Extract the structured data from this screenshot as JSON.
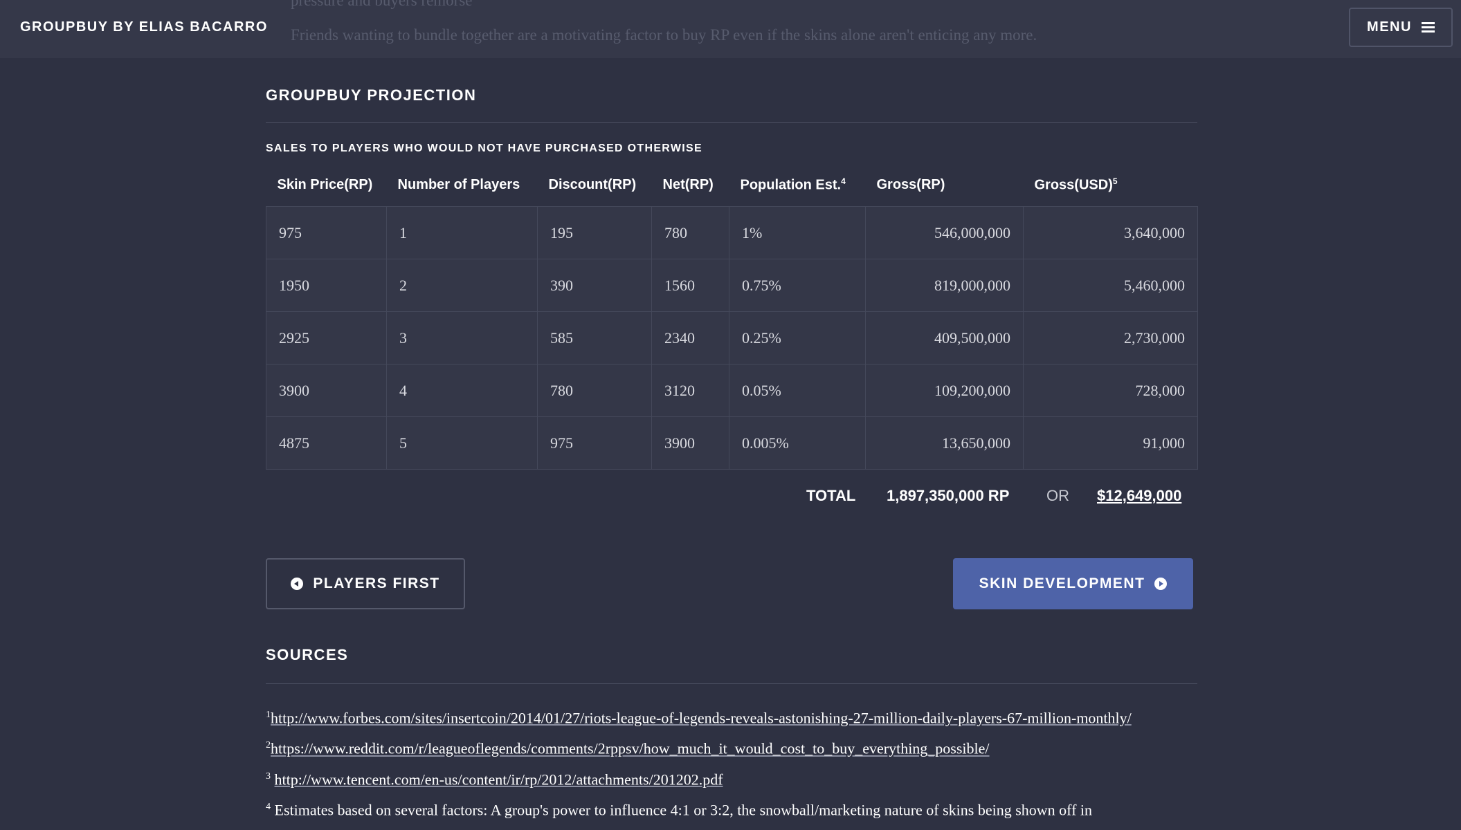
{
  "header": {
    "brand": "GROUPBUY BY ELIAS BACARRO",
    "menu_label": "MENU",
    "ghost_line_1": "pressure and buyers remorse",
    "ghost_line_2": "Friends wanting to bundle together are a motivating factor to buy RP even if the skins alone aren't enticing any more."
  },
  "projection": {
    "title": "GROUPBUY PROJECTION",
    "subtitle": "SALES TO PLAYERS WHO WOULD NOT HAVE PURCHASED OTHERWISE",
    "columns": [
      {
        "label": "Skin Price(RP)",
        "sup": ""
      },
      {
        "label": "Number of Players",
        "sup": ""
      },
      {
        "label": "Discount(RP)",
        "sup": ""
      },
      {
        "label": "Net(RP)",
        "sup": ""
      },
      {
        "label": "Population Est.",
        "sup": "4"
      },
      {
        "label": "Gross(RP)",
        "sup": ""
      },
      {
        "label": "Gross(USD)",
        "sup": "5"
      }
    ],
    "rows": [
      [
        "975",
        "1",
        "195",
        "780",
        "1%",
        "546,000,000",
        "3,640,000"
      ],
      [
        "1950",
        "2",
        "390",
        "1560",
        "0.75%",
        "819,000,000",
        "5,460,000"
      ],
      [
        "2925",
        "3",
        "585",
        "2340",
        "0.25%",
        "409,500,000",
        "2,730,000"
      ],
      [
        "3900",
        "4",
        "780",
        "3120",
        "0.05%",
        "109,200,000",
        "728,000"
      ],
      [
        "4875",
        "5",
        "975",
        "3900",
        "0.005%",
        "13,650,000",
        "91,000"
      ]
    ],
    "total_label": "TOTAL",
    "total_rp": "1,897,350,000 RP",
    "total_or": "OR",
    "total_usd": "$12,649,000"
  },
  "nav": {
    "prev_label": "PLAYERS FIRST",
    "next_label": "SKIN DEVELOPMENT"
  },
  "sources": {
    "title": "SOURCES",
    "items": [
      {
        "num": "1",
        "text": "http://www.forbes.com/sites/insertcoin/2014/01/27/riots-league-of-legends-reveals-astonishing-27-million-daily-players-67-million-monthly/"
      },
      {
        "num": "2",
        "text": "https://www.reddit.com/r/leagueoflegends/comments/2rppsv/how_much_it_would_cost_to_buy_everything_possible/"
      },
      {
        "num": "3",
        "text": "http://www.tencent.com/en-us/content/ir/rp/2012/attachments/201202.pdf"
      },
      {
        "num": "4",
        "text": "Estimates based on several factors: A group's power to influence 4:1 or 3:2, the snowball/marketing nature of skins being shown off in"
      }
    ]
  },
  "colors": {
    "background": "#2e3142",
    "topbar": "#353849",
    "accent_button": "#4e63a8"
  }
}
